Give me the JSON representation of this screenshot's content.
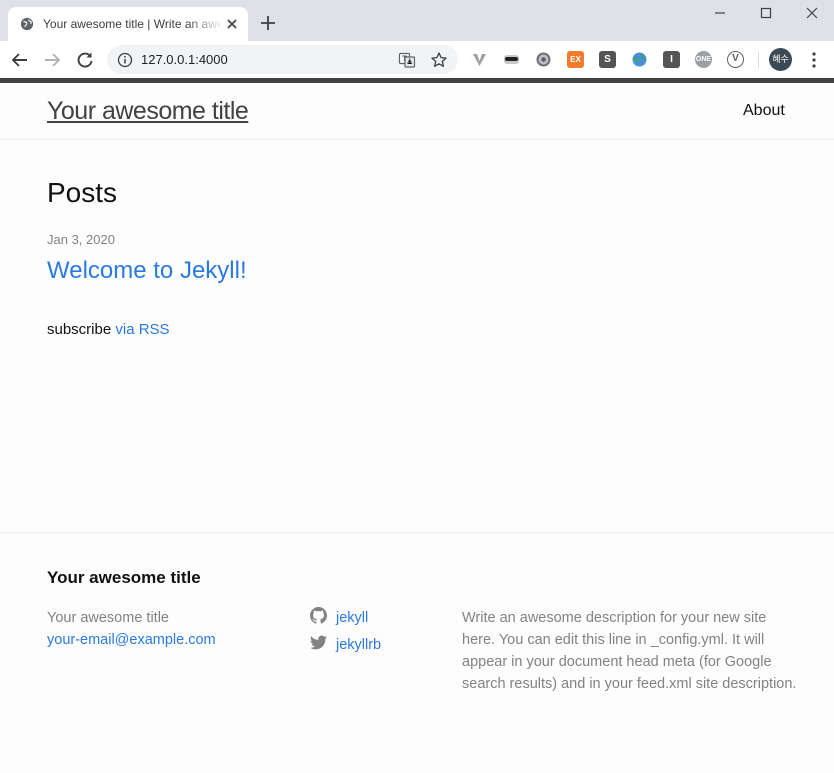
{
  "browser": {
    "tab_title": "Your awesome title | Write an awesome description",
    "url": "127.0.0.1:4000",
    "extensions": [
      {
        "name": "vivaldi-v",
        "label": "",
        "color": "#9aa0a6"
      },
      {
        "name": "mask",
        "label": "",
        "color": "#5f6368"
      },
      {
        "name": "gear",
        "label": "",
        "color": "#5f6368"
      },
      {
        "name": "ex",
        "label": "EX",
        "color": "#f07a2e"
      },
      {
        "name": "s",
        "label": "S",
        "color": "#555555"
      },
      {
        "name": "globe",
        "label": "",
        "color": "#34a853"
      },
      {
        "name": "i",
        "label": "I",
        "color": "#555555"
      },
      {
        "name": "one",
        "label": "ONE",
        "color": "#9aa0a6"
      },
      {
        "name": "v-circle",
        "label": "V",
        "color": "#5f6368"
      }
    ],
    "profile_initials": "혜수"
  },
  "header": {
    "site_title": "Your awesome title",
    "nav": [
      "About"
    ]
  },
  "main": {
    "heading": "Posts",
    "posts": [
      {
        "date": "Jan 3, 2020",
        "title": "Welcome to Jekyll!"
      }
    ],
    "subscribe_prefix": "subscribe",
    "subscribe_link": "via RSS"
  },
  "footer": {
    "heading": "Your awesome title",
    "name": "Your awesome title",
    "email": "your-email@example.com",
    "github": "jekyll",
    "twitter": "jekyllrb",
    "description": "Write an awesome description for your new site here. You can edit this line in _config.yml. It will appear in your document head meta (for Google search results) and in your feed.xml site description."
  },
  "colors": {
    "link": "#2a7ae2",
    "text": "#111111",
    "muted": "#828282",
    "top_bar": "#424242"
  }
}
